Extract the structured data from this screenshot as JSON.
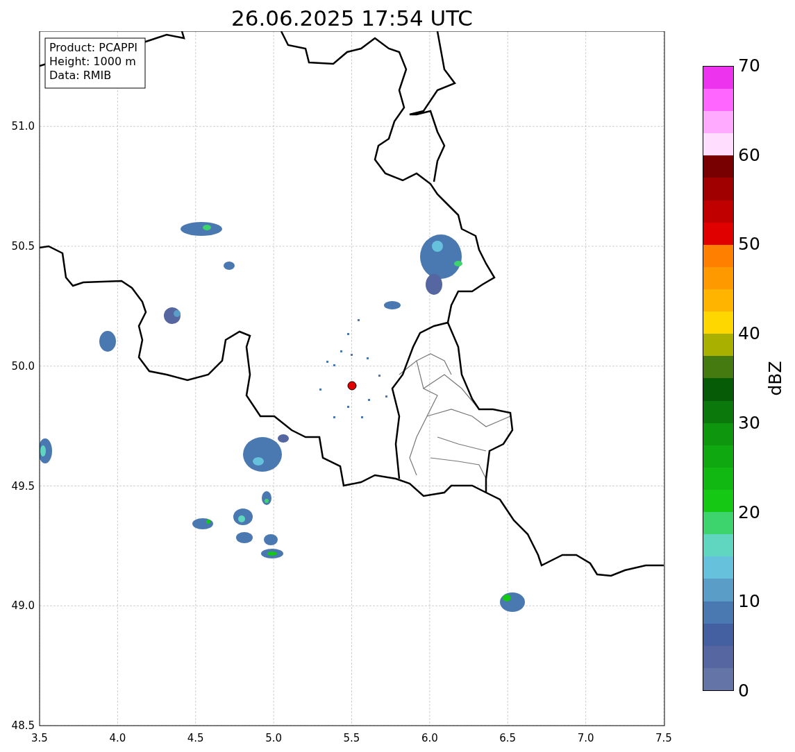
{
  "title": "26.06.2025 17:54 UTC",
  "info_box": [
    "Product: PCAPPI",
    "Height: 1000 m",
    "Data: RMIB"
  ],
  "map": {
    "xticks": [
      "3.5",
      "4.0",
      "4.5",
      "5.0",
      "5.5",
      "6.0",
      "6.5",
      "7.0",
      "7.5"
    ],
    "yticks": [
      "51.0",
      "50.5",
      "50.0",
      "49.5",
      "49.0",
      "48.5"
    ]
  },
  "colorbar": {
    "label": "dBZ",
    "ticks": [
      "70",
      "60",
      "50",
      "40",
      "30",
      "20",
      "10",
      "0"
    ],
    "bands": [
      {
        "color": "#6474a6"
      },
      {
        "color": "#5566a0"
      },
      {
        "color": "#4560a0"
      },
      {
        "color": "#4a78b0"
      },
      {
        "color": "#5a9ec8"
      },
      {
        "color": "#66c2dc"
      },
      {
        "color": "#60d6c0"
      },
      {
        "color": "#3dd46e"
      },
      {
        "color": "#14c814"
      },
      {
        "color": "#12b812"
      },
      {
        "color": "#10a810"
      },
      {
        "color": "#0e960e"
      },
      {
        "color": "#0a780a"
      },
      {
        "color": "#065c06"
      },
      {
        "color": "#457a10"
      },
      {
        "color": "#aab000"
      },
      {
        "color": "#ffd700"
      },
      {
        "color": "#ffb400"
      },
      {
        "color": "#ff9900"
      },
      {
        "color": "#ff7f00"
      },
      {
        "color": "#e00000"
      },
      {
        "color": "#c00000"
      },
      {
        "color": "#a00000"
      },
      {
        "color": "#780000"
      },
      {
        "color": "#ffddff"
      },
      {
        "color": "#ffaaff"
      },
      {
        "color": "#ff66ff"
      },
      {
        "color": "#ee33ee"
      }
    ]
  }
}
